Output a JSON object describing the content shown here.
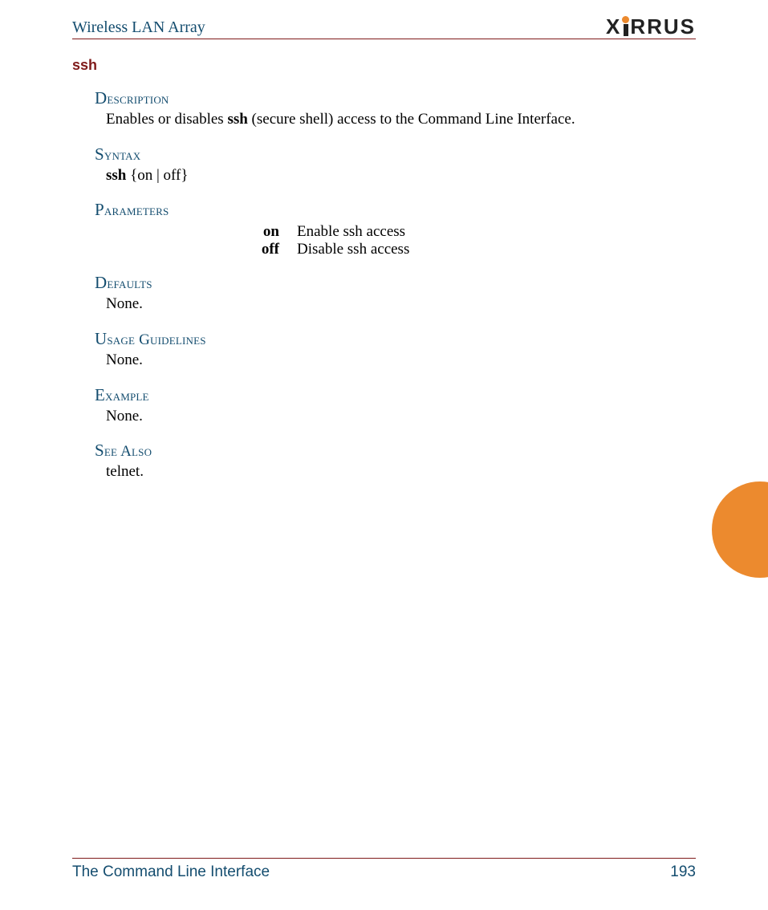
{
  "header": {
    "title": "Wireless LAN Array",
    "logo_text_left": "X",
    "logo_text_right": "RRUS"
  },
  "command": {
    "name": "ssh"
  },
  "sections": {
    "description": {
      "heading": "Description",
      "text_pre": "Enables or disables ",
      "text_bold": "ssh",
      "text_post": " (secure shell) access to the Command Line Interface."
    },
    "syntax": {
      "heading": "Syntax",
      "cmd_bold": "ssh",
      "cmd_rest": "  {on | off}"
    },
    "parameters": {
      "heading": "Parameters",
      "rows": [
        {
          "name": "on",
          "desc": "Enable ssh access"
        },
        {
          "name": "off",
          "desc": "Disable ssh access"
        }
      ]
    },
    "defaults": {
      "heading": "Defaults",
      "text": "None."
    },
    "usage": {
      "heading": "Usage Guidelines",
      "text": "None."
    },
    "example": {
      "heading": "Example",
      "text": "None."
    },
    "seealso": {
      "heading": "See Also",
      "text": "telnet."
    }
  },
  "footer": {
    "section": "The Command Line Interface",
    "page": "193"
  }
}
